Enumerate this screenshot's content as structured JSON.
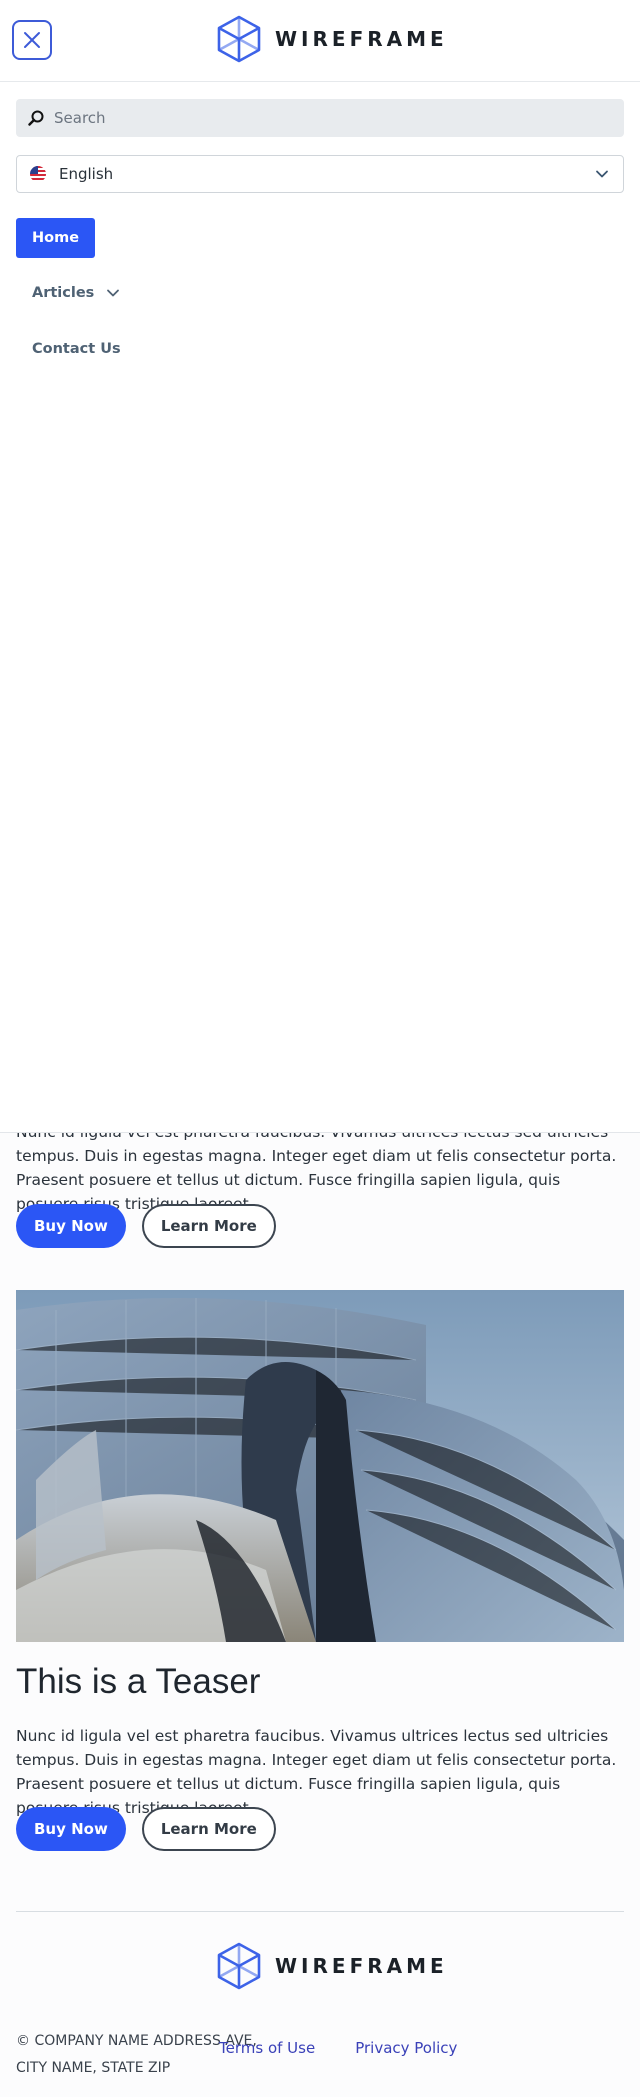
{
  "header": {
    "logo_text": "WIREFRAME",
    "close_label": "Close menu"
  },
  "menu": {
    "search_placeholder": "Search",
    "language": "English",
    "nav": {
      "home": "Home",
      "articles": "Articles",
      "contact": "Contact Us"
    }
  },
  "teaser_1": {
    "text": "Nunc id ligula vel est pharetra faucibus. Vivamus ultrices lectus sed ultricies tempus. Duis in egestas magna. Integer eget diam ut felis consectetur porta. Praesent posuere et tellus ut dictum. Fusce fringilla sapien ligula, quis posuere risus tristique laoreet.",
    "primary_button": "Buy Now",
    "secondary_button": "Learn More"
  },
  "teaser_2": {
    "title": "This is a Teaser",
    "text": "Nunc id ligula vel est pharetra faucibus. Vivamus ultrices lectus sed ultricies tempus. Duis in egestas magna. Integer eget diam ut felis consectetur porta. Praesent posuere et tellus ut dictum. Fusce fringilla sapien ligula, quis posuere risus tristique laoreet.",
    "primary_button": "Buy Now",
    "secondary_button": "Learn More",
    "image": "building-photo"
  },
  "footer": {
    "logo_text": "WIREFRAME",
    "address": "© COMPANY NAME ADDRESS AVE, CITY NAME, STATE ZIP",
    "links": [
      "Terms of Use",
      "Privacy Policy"
    ]
  },
  "colors": {
    "primary": "#2b56f5",
    "logo_blue": "#3d63e8",
    "link": "#3a41b8"
  },
  "icons": {
    "close": "close-icon",
    "search": "search-icon",
    "language": "us-flag-icon",
    "dropdown": "chevron-down-icon",
    "logo": "cube-logo-icon"
  }
}
